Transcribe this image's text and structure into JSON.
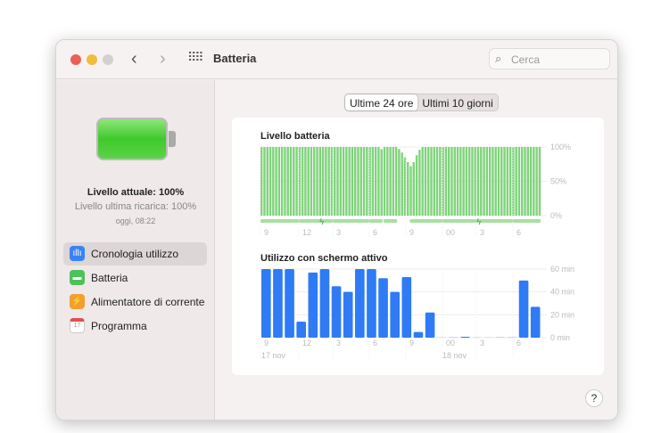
{
  "window": {
    "title": "Batteria",
    "search_placeholder": "Cerca"
  },
  "sidebar": {
    "current_level": "Livello attuale: 100%",
    "last_charge": "Livello ultima ricarica: 100%",
    "last_charge_time": "oggi, 08:22",
    "items": [
      {
        "label": "Cronologia utilizzo",
        "icon": "bar-chart-icon",
        "color": "#3b82f6",
        "selected": true
      },
      {
        "label": "Batteria",
        "icon": "battery-icon",
        "color": "#4cc25a"
      },
      {
        "label": "Alimentatore di corrente",
        "icon": "bolt-icon",
        "color": "#f0a030"
      },
      {
        "label": "Programma",
        "icon": "calendar-icon",
        "color": "#d8d2d2"
      }
    ]
  },
  "tabs": [
    {
      "label": "Ultime 24 ore",
      "selected": true
    },
    {
      "label": "Ultimi 10 giorni"
    }
  ],
  "help_label": "?",
  "chart_data": [
    {
      "type": "bar",
      "title": "Livello batteria",
      "ylim": [
        0,
        100
      ],
      "y_ticks": [
        "100%",
        "50%",
        "0%"
      ],
      "x_ticks": [
        "9",
        "12",
        "3",
        "6",
        "9",
        "00",
        "3",
        "6"
      ],
      "interval": "15 min",
      "color": "#7ed37a",
      "values": [
        100,
        100,
        100,
        100,
        100,
        100,
        100,
        100,
        100,
        100,
        100,
        100,
        100,
        100,
        100,
        100,
        100,
        100,
        100,
        100,
        100,
        100,
        100,
        100,
        100,
        100,
        100,
        100,
        100,
        100,
        100,
        100,
        100,
        100,
        100,
        100,
        100,
        100,
        100,
        100,
        100,
        97,
        100,
        100,
        100,
        100,
        100,
        97,
        92,
        85,
        78,
        72,
        78,
        88,
        96,
        100,
        100,
        100,
        100,
        100,
        100,
        100,
        100,
        100,
        100,
        100,
        100,
        100,
        100,
        100,
        100,
        100,
        100,
        100,
        100,
        100,
        100,
        100,
        100,
        100,
        100,
        100,
        100,
        100,
        100,
        100,
        100,
        100,
        100,
        100,
        100,
        100,
        100,
        100,
        100,
        100
      ],
      "charging_periods": [
        [
          "09:00",
          "19:15"
        ],
        [
          "19:30",
          "20:30"
        ],
        [
          "21:45",
          "08:45"
        ]
      ]
    },
    {
      "type": "bar",
      "title": "Utilizzo con schermo attivo",
      "ylim": [
        0,
        60
      ],
      "y_ticks": [
        "60 min",
        "40 min",
        "20 min",
        "0 min"
      ],
      "x_ticks": [
        "9",
        "12",
        "3",
        "6",
        "9",
        "00",
        "3",
        "6"
      ],
      "dates": [
        "17 nov",
        "18 nov"
      ],
      "color": "#2f7bf5",
      "categories": [
        "9",
        "10",
        "11",
        "12",
        "13",
        "14",
        "15",
        "16",
        "17",
        "18",
        "19",
        "20",
        "21",
        "22",
        "23",
        "0",
        "1",
        "2",
        "3",
        "4",
        "5",
        "6",
        "7",
        "8"
      ],
      "values": [
        60,
        60,
        60,
        14,
        57,
        60,
        45,
        40,
        60,
        60,
        52,
        40,
        53,
        5,
        22,
        0,
        0.3,
        0.8,
        0,
        0,
        0.3,
        0.3,
        50,
        27
      ]
    }
  ]
}
